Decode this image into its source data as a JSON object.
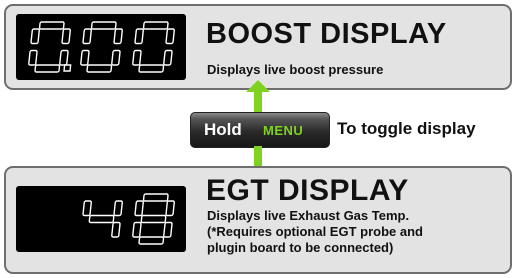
{
  "boost": {
    "readout": "0.00",
    "title": "BOOST DISPLAY",
    "description": "Displays live boost pressure"
  },
  "egt": {
    "readout": "48",
    "title": "EGT DISPLAY",
    "description_lines": [
      "Displays live Exhaust Gas Temp.",
      "(*Requires optional EGT probe and",
      "plugin board to be connected)"
    ]
  },
  "toggle": {
    "hold": "Hold",
    "menu": "MENU",
    "text": "To toggle display"
  },
  "colors": {
    "arrow": "#7fd320",
    "menu_text": "#7fd320",
    "panel_bg": "#e3e3e3",
    "lcd_bg": "#000000"
  }
}
